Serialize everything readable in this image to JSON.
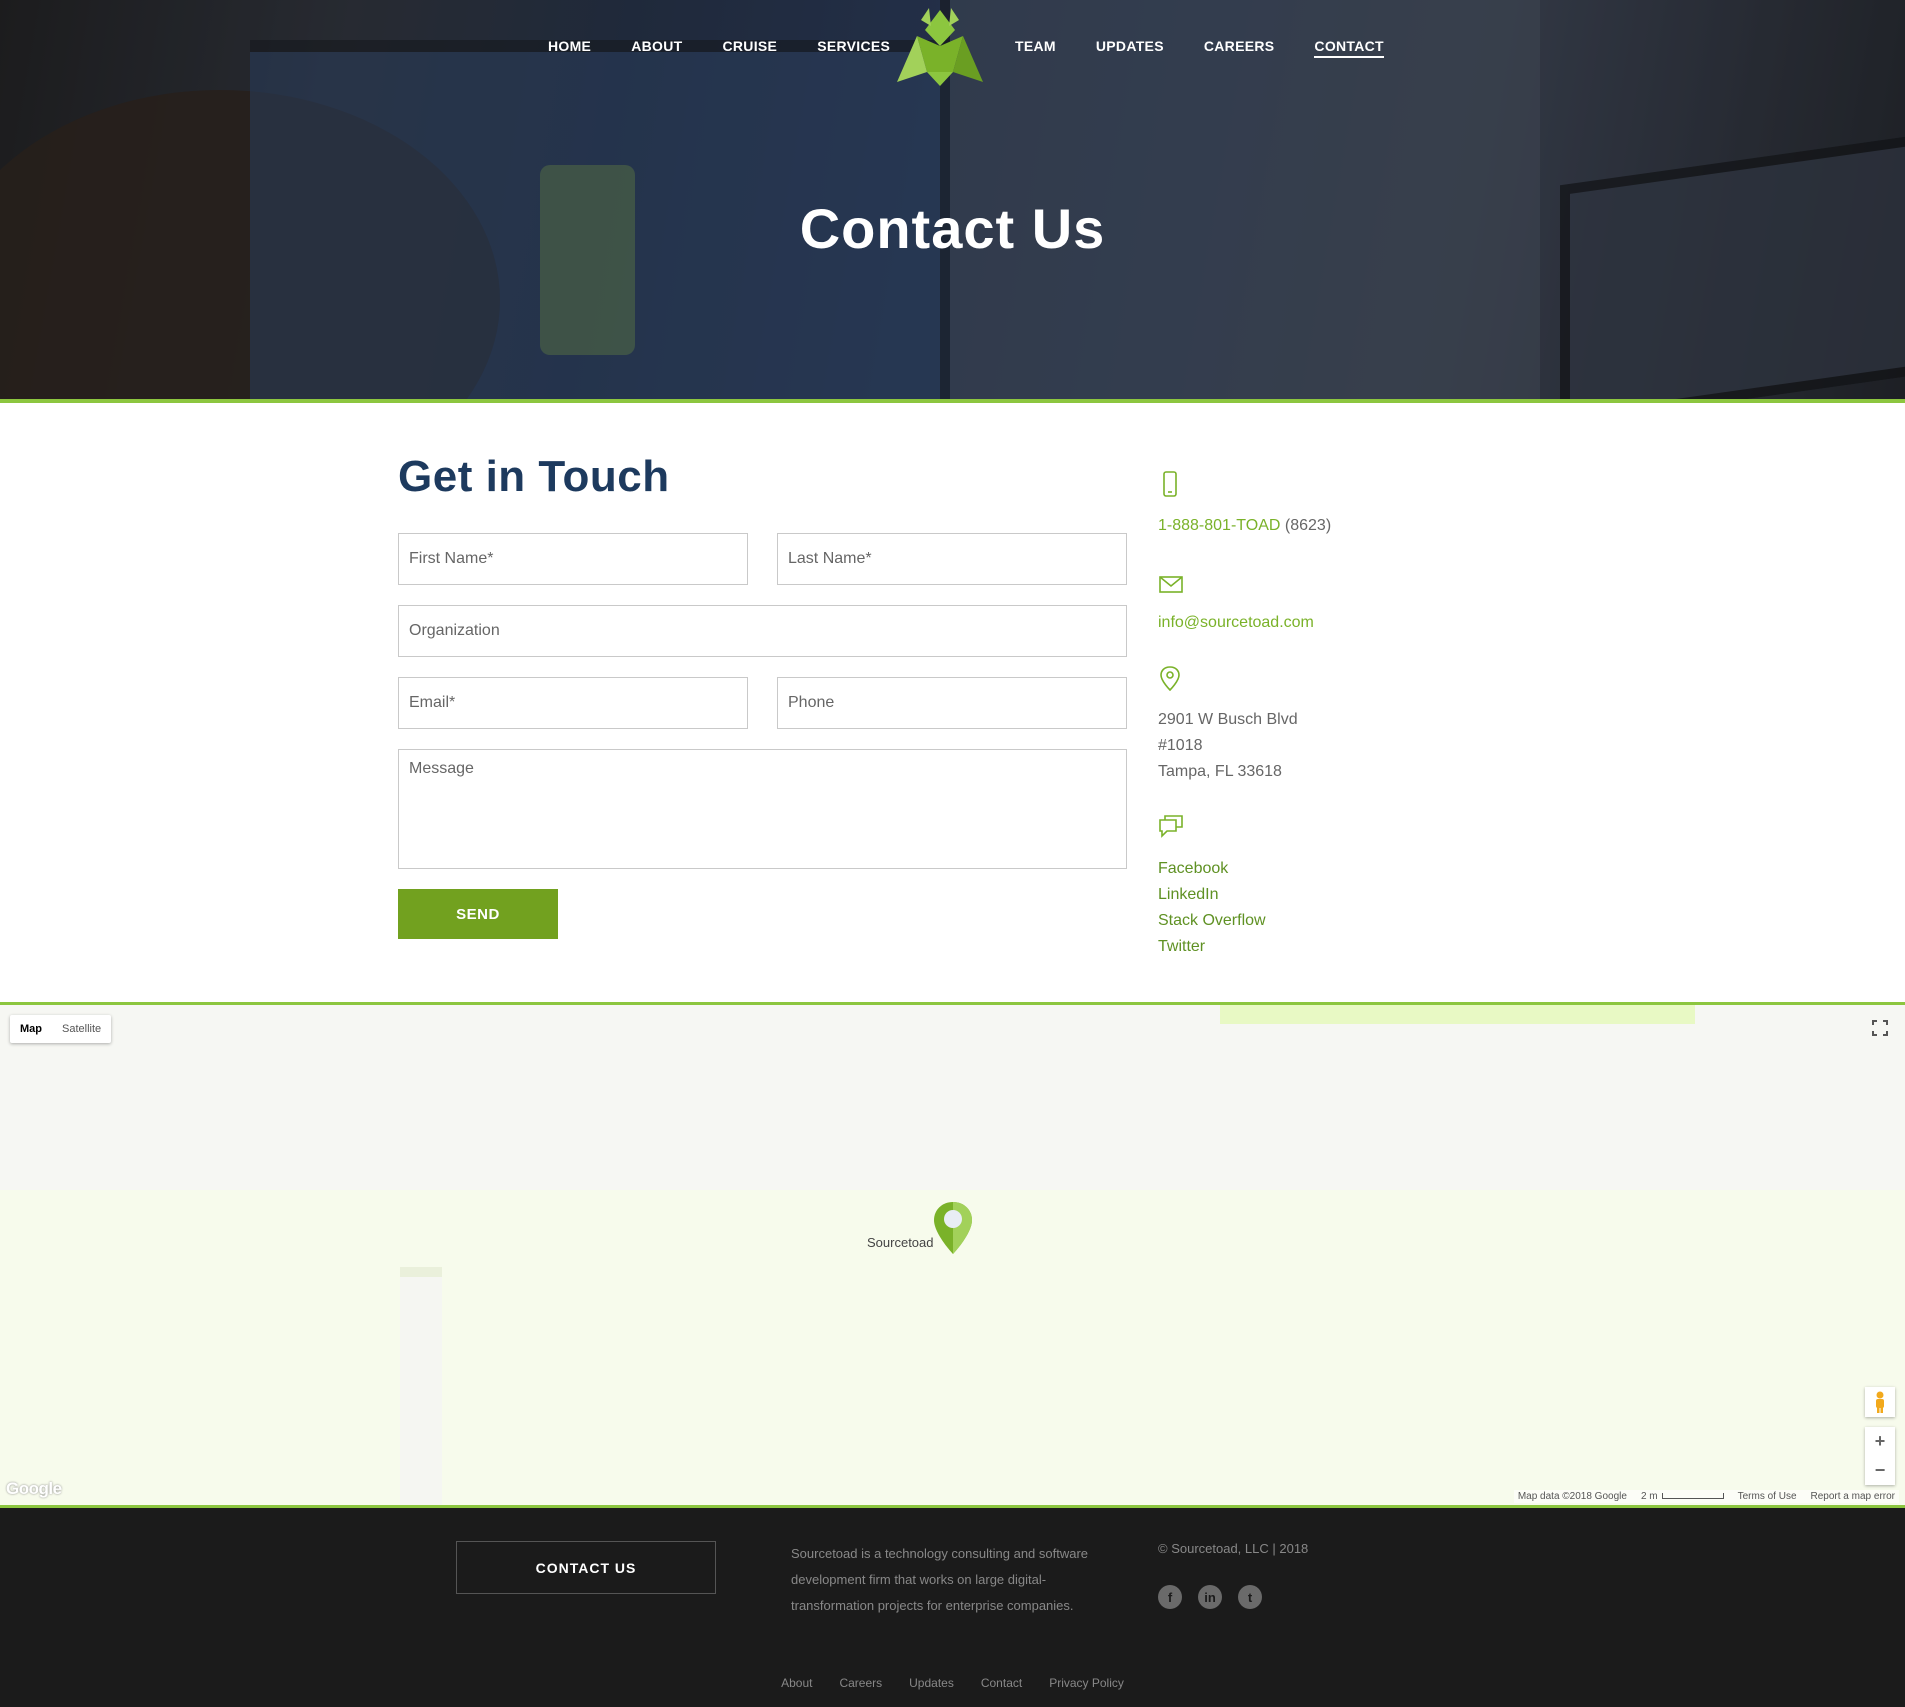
{
  "nav": {
    "left": [
      "HOME",
      "ABOUT",
      "CRUISE",
      "SERVICES"
    ],
    "right": [
      "TEAM",
      "UPDATES",
      "CAREERS",
      "CONTACT"
    ],
    "active": "CONTACT"
  },
  "hero": {
    "title": "Contact Us"
  },
  "form": {
    "title": "Get in Touch",
    "first_name_placeholder": "First Name*",
    "last_name_placeholder": "Last Name*",
    "organization_placeholder": "Organization",
    "email_placeholder": "Email*",
    "phone_placeholder": "Phone",
    "message_placeholder": "Message",
    "send_label": "SEND"
  },
  "contact": {
    "phone_link": "1-888-801-TOAD",
    "phone_suffix": "(8623)",
    "email": "info@sourcetoad.com",
    "address_line1": "2901 W Busch Blvd",
    "address_line2": "#1018",
    "address_line3": "Tampa, FL 33618",
    "social": [
      "Facebook",
      "LinkedIn",
      "Stack Overflow",
      "Twitter"
    ]
  },
  "map": {
    "type_map": "Map",
    "type_satellite": "Satellite",
    "pin_label": "Sourcetoad",
    "google": "Google",
    "data": "Map data ©2018 Google",
    "scale": "2 m",
    "terms": "Terms of Use",
    "report": "Report a map error",
    "zoom_in": "+",
    "zoom_out": "−"
  },
  "footer": {
    "button": "CONTACT US",
    "description": "Sourcetoad is a technology consulting and software development firm that works on large digital-transformation projects for enterprise companies.",
    "copyright": "© Sourcetoad, LLC | 2018",
    "links": [
      "About",
      "Careers",
      "Updates",
      "Contact",
      "Privacy Policy"
    ]
  },
  "colors": {
    "accent": "#8cc63f",
    "button": "#72a11f",
    "title": "#1d3a5e",
    "footer_bg": "#1b1b1b"
  }
}
